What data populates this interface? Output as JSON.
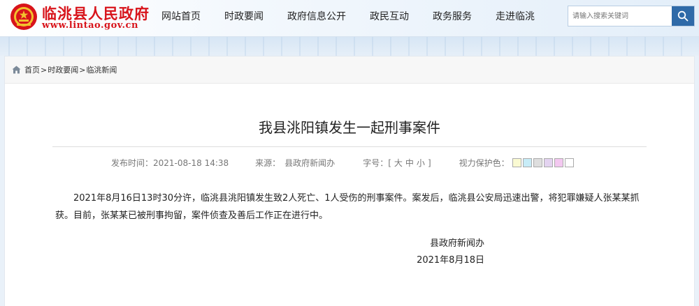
{
  "header": {
    "site_title": "临洮县人民政府",
    "site_url": "www.lintao.gov.cn",
    "nav": [
      "网站首页",
      "时政要闻",
      "政府信息公开",
      "政民互动",
      "政务服务",
      "走进临洮"
    ],
    "search_placeholder": "请输入搜索关键词",
    "emblem_icon": "national-emblem-icon",
    "search_icon": "magnifier-icon"
  },
  "breadcrumb": {
    "home": "首页",
    "section": "时政要闻",
    "current": "临洮新闻",
    "separator": ">"
  },
  "article": {
    "title": "我县洮阳镇发生一起刑事案件",
    "publish_label": "发布时间：",
    "publish_time": "2021-08-18 14:38",
    "source_label": "来源：",
    "source": "县政府新闻办",
    "fontsize_label": "字号：",
    "fontsize_open": "[",
    "fontsize_large": "大",
    "fontsize_medium": "中",
    "fontsize_small": "小",
    "fontsize_close": "]",
    "eye_label": "视力保护色：",
    "eye_colors": [
      "#fafad2",
      "#c7ecf7",
      "#dedede",
      "#e3d3f0",
      "#f3c8f0",
      "#ffffff"
    ],
    "body": "2021年8月16日13时30分许，临洮县洮阳镇发生致2人死亡、1人受伤的刑事案件。案发后，临洮县公安局迅速出警，将犯罪嫌疑人张某某抓获。目前，张某某已被刑事拘留，案件侦查及善后工作正在进行中。",
    "signature_org": "县政府新闻办",
    "signature_date": "2021年8月18日"
  },
  "colors": {
    "brand_red": "#d8141b",
    "search_button": "#2f6aa8",
    "page_background": "#e9f1f9"
  }
}
